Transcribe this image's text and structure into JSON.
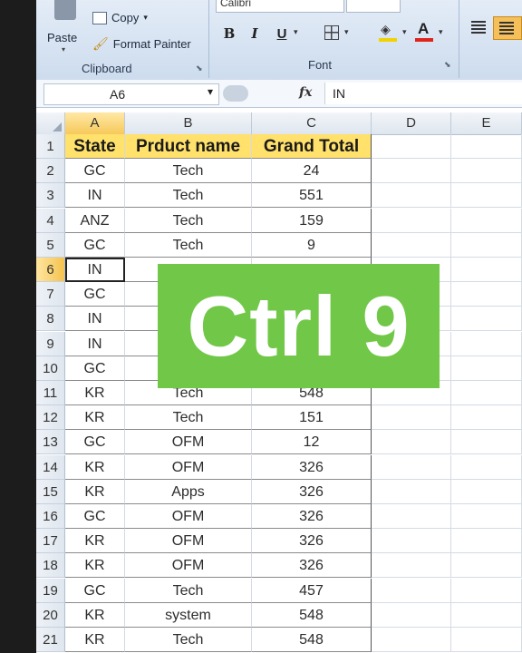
{
  "ribbon": {
    "paste_label": "Paste",
    "copy_label": "Copy",
    "format_painter_label": "Format Painter",
    "clipboard_group": "Clipboard",
    "font_name": "Calibri",
    "bold": "B",
    "italic": "I",
    "underline": "U",
    "font_group": "Font"
  },
  "formula_bar": {
    "name_box": "A6",
    "fx": "fx",
    "value": "IN"
  },
  "columns": [
    "A",
    "B",
    "C",
    "D",
    "E"
  ],
  "table": {
    "headers": [
      "State",
      "Prduct name",
      "Grand Total"
    ],
    "rows": [
      {
        "n": "2",
        "state": "GC",
        "product": "Tech",
        "total": "24"
      },
      {
        "n": "3",
        "state": "IN",
        "product": "Tech",
        "total": "551"
      },
      {
        "n": "4",
        "state": "ANZ",
        "product": "Tech",
        "total": "159"
      },
      {
        "n": "5",
        "state": "GC",
        "product": "Tech",
        "total": "9"
      },
      {
        "n": "6",
        "state": "IN",
        "product": "",
        "total": ""
      },
      {
        "n": "7",
        "state": "GC",
        "product": "",
        "total": ""
      },
      {
        "n": "8",
        "state": "IN",
        "product": "",
        "total": ""
      },
      {
        "n": "9",
        "state": "IN",
        "product": "",
        "total": ""
      },
      {
        "n": "10",
        "state": "GC",
        "product": "",
        "total": ""
      },
      {
        "n": "11",
        "state": "KR",
        "product": "Tech",
        "total": "548"
      },
      {
        "n": "12",
        "state": "KR",
        "product": "Tech",
        "total": "151"
      },
      {
        "n": "13",
        "state": "GC",
        "product": "OFM",
        "total": "12"
      },
      {
        "n": "14",
        "state": "KR",
        "product": "OFM",
        "total": "326"
      },
      {
        "n": "15",
        "state": "KR",
        "product": "Apps",
        "total": "326"
      },
      {
        "n": "16",
        "state": "GC",
        "product": "OFM",
        "total": "326"
      },
      {
        "n": "17",
        "state": "KR",
        "product": "OFM",
        "total": "326"
      },
      {
        "n": "18",
        "state": "KR",
        "product": "OFM",
        "total": "326"
      },
      {
        "n": "19",
        "state": "GC",
        "product": "Tech",
        "total": "457"
      },
      {
        "n": "20",
        "state": "KR",
        "product": "system",
        "total": "548"
      },
      {
        "n": "21",
        "state": "KR",
        "product": "Tech",
        "total": "548"
      }
    ]
  },
  "overlay": {
    "text": "Ctrl 9",
    "color": "#71c848"
  },
  "selected_row": "6",
  "selected_column": "A"
}
